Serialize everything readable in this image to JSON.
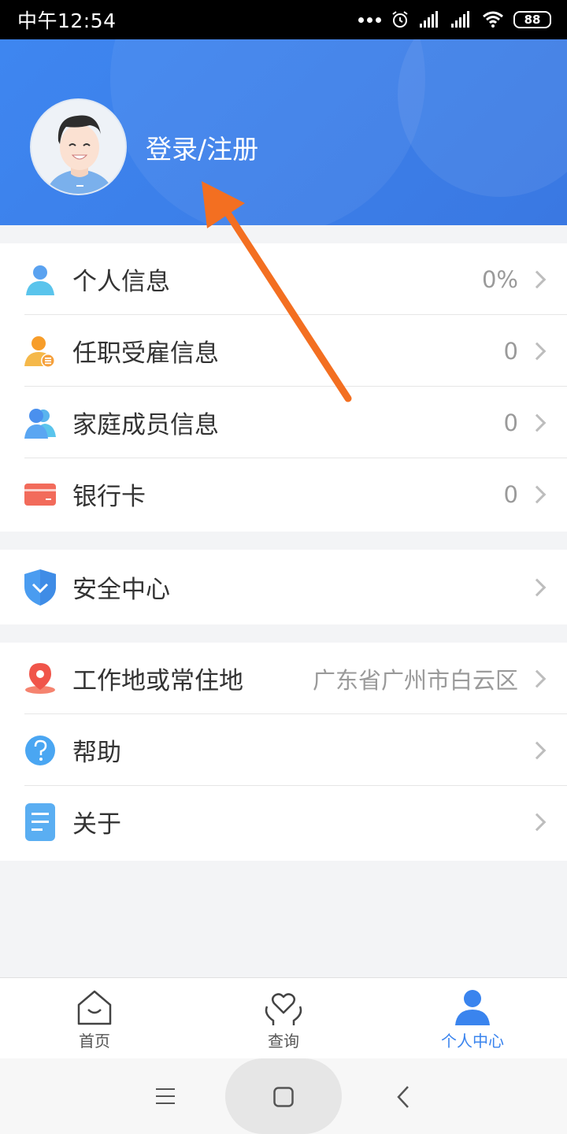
{
  "status_bar": {
    "time": "中午12:54",
    "battery": "88"
  },
  "header": {
    "login_label": "登录/注册"
  },
  "menu_section_1": [
    {
      "label": "个人信息",
      "value": "0%",
      "icon": "person-icon"
    },
    {
      "label": "任职受雇信息",
      "value": "0",
      "icon": "employment-icon"
    },
    {
      "label": "家庭成员信息",
      "value": "0",
      "icon": "family-icon"
    },
    {
      "label": "银行卡",
      "value": "0",
      "icon": "bank-card-icon"
    }
  ],
  "menu_section_2": [
    {
      "label": "安全中心",
      "icon": "shield-icon"
    }
  ],
  "menu_section_3": [
    {
      "label": "工作地或常住地",
      "value": "广东省广州市白云区",
      "icon": "location-pin-icon"
    },
    {
      "label": "帮助",
      "icon": "help-icon"
    },
    {
      "label": "关于",
      "icon": "document-icon"
    }
  ],
  "bottom_nav": [
    {
      "label": "首页",
      "icon": "home-icon",
      "active": false
    },
    {
      "label": "查询",
      "icon": "heart-hands-icon",
      "active": false
    },
    {
      "label": "个人中心",
      "icon": "user-icon",
      "active": true
    }
  ],
  "colors": {
    "brand_blue": "#3a84ee",
    "arrow": "#f36f21"
  }
}
